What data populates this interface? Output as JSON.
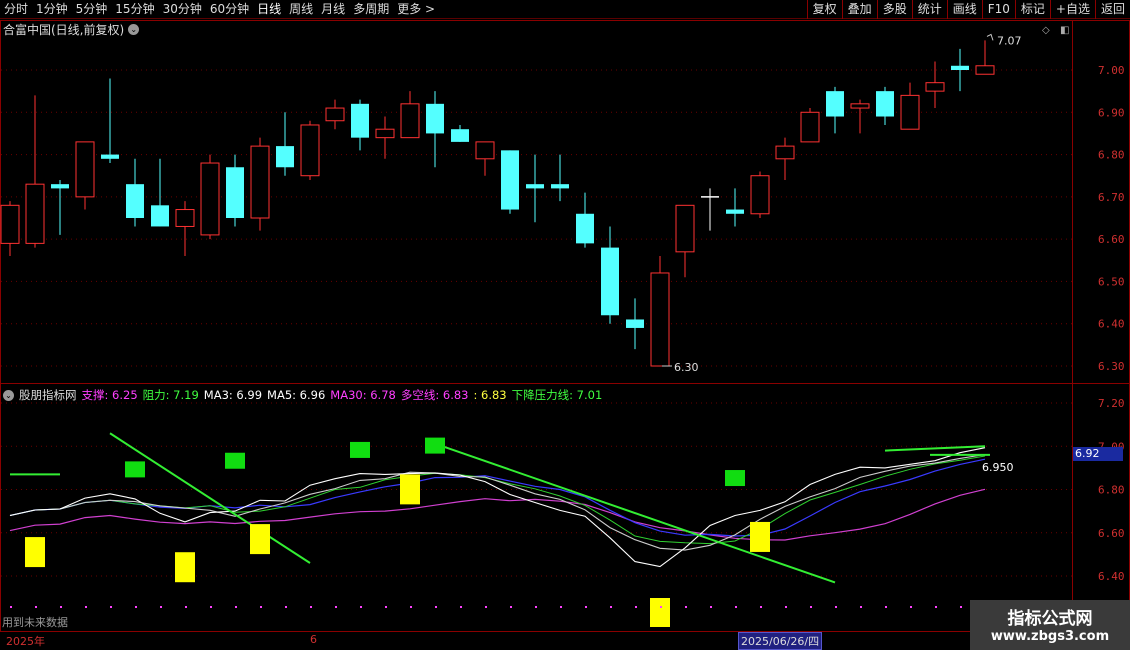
{
  "toolbar": {
    "left": [
      "分时",
      "1分钟",
      "5分钟",
      "15分钟",
      "30分钟",
      "60分钟",
      "日线",
      "周线",
      "月线",
      "多周期",
      "更多 >"
    ],
    "right": [
      "复权",
      "叠加",
      "多股",
      "统计",
      "画线",
      "F10",
      "标记",
      "+自选",
      "返回"
    ]
  },
  "main": {
    "title": "合富中国(日线,前复权)",
    "y_ticks": [
      "7.00",
      "6.90",
      "6.80",
      "6.70",
      "6.60",
      "6.50",
      "6.40",
      "6.30"
    ],
    "high_label": "7.07",
    "low_label": "6.30"
  },
  "indicator": {
    "name": "股朋指标网",
    "values": [
      {
        "label": "支撑: 6.25",
        "color": "#ff40ff"
      },
      {
        "label": "阻力: 7.19",
        "color": "#40ff40"
      },
      {
        "label": "MA3: 6.99",
        "color": "#ffffff"
      },
      {
        "label": "MA5: 6.96",
        "color": "#ffffff"
      },
      {
        "label": "MA30: 6.78",
        "color": "#ff40ff"
      },
      {
        "label": "多空线: 6.83",
        "color": "#ff40ff"
      },
      {
        "label": ": 6.83",
        "color": "#ffff40"
      },
      {
        "label": "下降压力线: 7.01",
        "color": "#40ff40"
      }
    ],
    "y_ticks": [
      "7.20",
      "7.00",
      "6.80",
      "6.60",
      "6.40"
    ],
    "current_value_tag": "6.92",
    "last_label": "6.950",
    "future_note": "用到未来数据"
  },
  "dates": {
    "year": "2025年",
    "month": "6",
    "selected": "2025/06/26/四"
  },
  "watermark": {
    "line1": "指标公式网",
    "line2": "www.zbgs3.com"
  },
  "colors": {
    "up": "#ff3232",
    "down": "#54ffff",
    "frame": "#8a0000",
    "grid": "#8a0000"
  },
  "candles": [
    {
      "o": 6.59,
      "c": 6.68,
      "h": 6.69,
      "l": 6.56
    },
    {
      "o": 6.59,
      "c": 6.73,
      "h": 6.94,
      "l": 6.58
    },
    {
      "o": 6.73,
      "c": 6.72,
      "h": 6.74,
      "l": 6.61
    },
    {
      "o": 6.7,
      "c": 6.83,
      "h": 6.83,
      "l": 6.67
    },
    {
      "o": 6.8,
      "c": 6.79,
      "h": 6.98,
      "l": 6.78
    },
    {
      "o": 6.73,
      "c": 6.65,
      "h": 6.79,
      "l": 6.63
    },
    {
      "o": 6.68,
      "c": 6.63,
      "h": 6.79,
      "l": 6.63
    },
    {
      "o": 6.63,
      "c": 6.67,
      "h": 6.69,
      "l": 6.56
    },
    {
      "o": 6.61,
      "c": 6.78,
      "h": 6.8,
      "l": 6.6
    },
    {
      "o": 6.77,
      "c": 6.65,
      "h": 6.8,
      "l": 6.63
    },
    {
      "o": 6.65,
      "c": 6.82,
      "h": 6.84,
      "l": 6.62
    },
    {
      "o": 6.82,
      "c": 6.77,
      "h": 6.9,
      "l": 6.75
    },
    {
      "o": 6.75,
      "c": 6.87,
      "h": 6.88,
      "l": 6.74
    },
    {
      "o": 6.88,
      "c": 6.91,
      "h": 6.93,
      "l": 6.86
    },
    {
      "o": 6.92,
      "c": 6.84,
      "h": 6.93,
      "l": 6.81
    },
    {
      "o": 6.84,
      "c": 6.86,
      "h": 6.89,
      "l": 6.79
    },
    {
      "o": 6.84,
      "c": 6.92,
      "h": 6.95,
      "l": 6.84
    },
    {
      "o": 6.92,
      "c": 6.85,
      "h": 6.95,
      "l": 6.77
    },
    {
      "o": 6.86,
      "c": 6.83,
      "h": 6.87,
      "l": 6.83
    },
    {
      "o": 6.79,
      "c": 6.83,
      "h": 6.83,
      "l": 6.75
    },
    {
      "o": 6.81,
      "c": 6.67,
      "h": 6.81,
      "l": 6.66
    },
    {
      "o": 6.73,
      "c": 6.72,
      "h": 6.8,
      "l": 6.64
    },
    {
      "o": 6.73,
      "c": 6.72,
      "h": 6.8,
      "l": 6.69
    },
    {
      "o": 6.66,
      "c": 6.59,
      "h": 6.71,
      "l": 6.58
    },
    {
      "o": 6.58,
      "c": 6.42,
      "h": 6.63,
      "l": 6.4
    },
    {
      "o": 6.41,
      "c": 6.39,
      "h": 6.46,
      "l": 6.34
    },
    {
      "o": 6.3,
      "c": 6.52,
      "h": 6.56,
      "l": 6.3
    },
    {
      "o": 6.57,
      "c": 6.68,
      "h": 6.68,
      "l": 6.51
    },
    {
      "o": 6.7,
      "c": 6.7,
      "h": 6.72,
      "l": 6.62
    },
    {
      "o": 6.67,
      "c": 6.66,
      "h": 6.72,
      "l": 6.63
    },
    {
      "o": 6.66,
      "c": 6.75,
      "h": 6.76,
      "l": 6.65
    },
    {
      "o": 6.79,
      "c": 6.82,
      "h": 6.84,
      "l": 6.74
    },
    {
      "o": 6.83,
      "c": 6.9,
      "h": 6.91,
      "l": 6.83
    },
    {
      "o": 6.95,
      "c": 6.89,
      "h": 6.96,
      "l": 6.85
    },
    {
      "o": 6.91,
      "c": 6.92,
      "h": 6.93,
      "l": 6.85
    },
    {
      "o": 6.95,
      "c": 6.89,
      "h": 6.96,
      "l": 6.87
    },
    {
      "o": 6.86,
      "c": 6.94,
      "h": 6.97,
      "l": 6.86
    },
    {
      "o": 6.95,
      "c": 6.97,
      "h": 7.02,
      "l": 6.91
    },
    {
      "o": 7.01,
      "c": 7.0,
      "h": 7.05,
      "l": 6.95
    },
    {
      "o": 6.99,
      "c": 7.01,
      "h": 7.07,
      "l": 6.99
    }
  ]
}
